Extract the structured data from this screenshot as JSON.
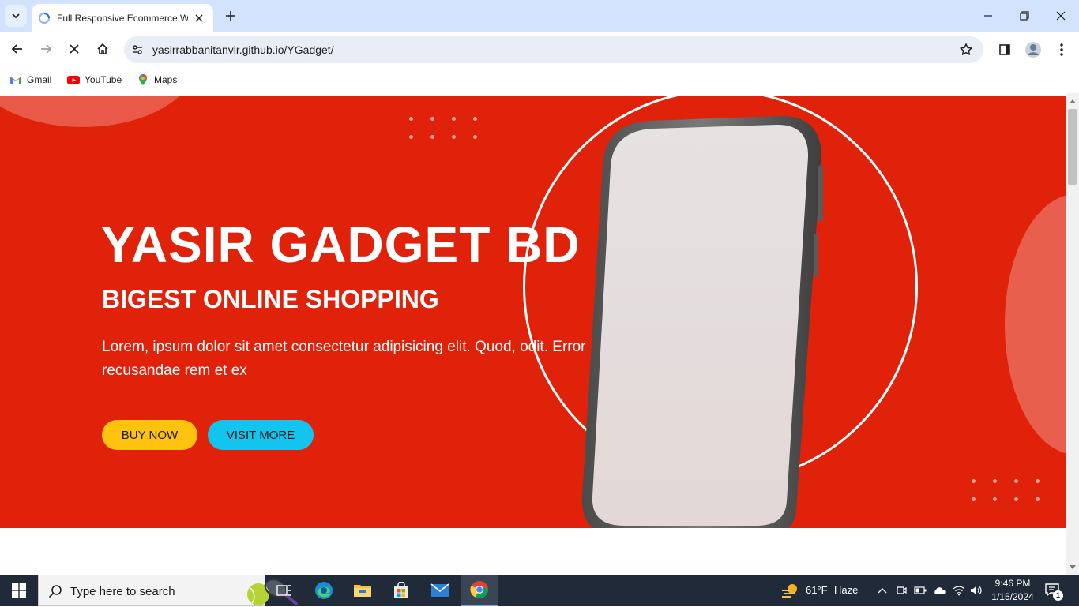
{
  "browser": {
    "tab_title": "Full Responsive Ecommerce We",
    "url": "yasirrabbanitanvir.github.io/YGadget/",
    "bookmarks": [
      {
        "label": "Gmail",
        "icon": "gmail-icon"
      },
      {
        "label": "YouTube",
        "icon": "youtube-icon"
      },
      {
        "label": "Maps",
        "icon": "maps-icon"
      }
    ]
  },
  "hero": {
    "title": "YASIR GADGET BD",
    "subtitle": "BIGEST ONLINE SHOPPING",
    "description": "Lorem, ipsum dolor sit amet consectetur adipisicing elit. Quod, odit. Error recusandae rem et ex",
    "buy_label": "BUY NOW",
    "visit_label": "VISIT MORE",
    "colors": {
      "background": "#e0220a",
      "buy": "#ffc20e",
      "visit": "#13c4ef"
    }
  },
  "taskbar": {
    "search_placeholder": "Type here to search",
    "weather_temp": "61°F",
    "weather_desc": "Haze",
    "time": "9:46 PM",
    "date": "1/15/2024",
    "notification_count": "1"
  }
}
